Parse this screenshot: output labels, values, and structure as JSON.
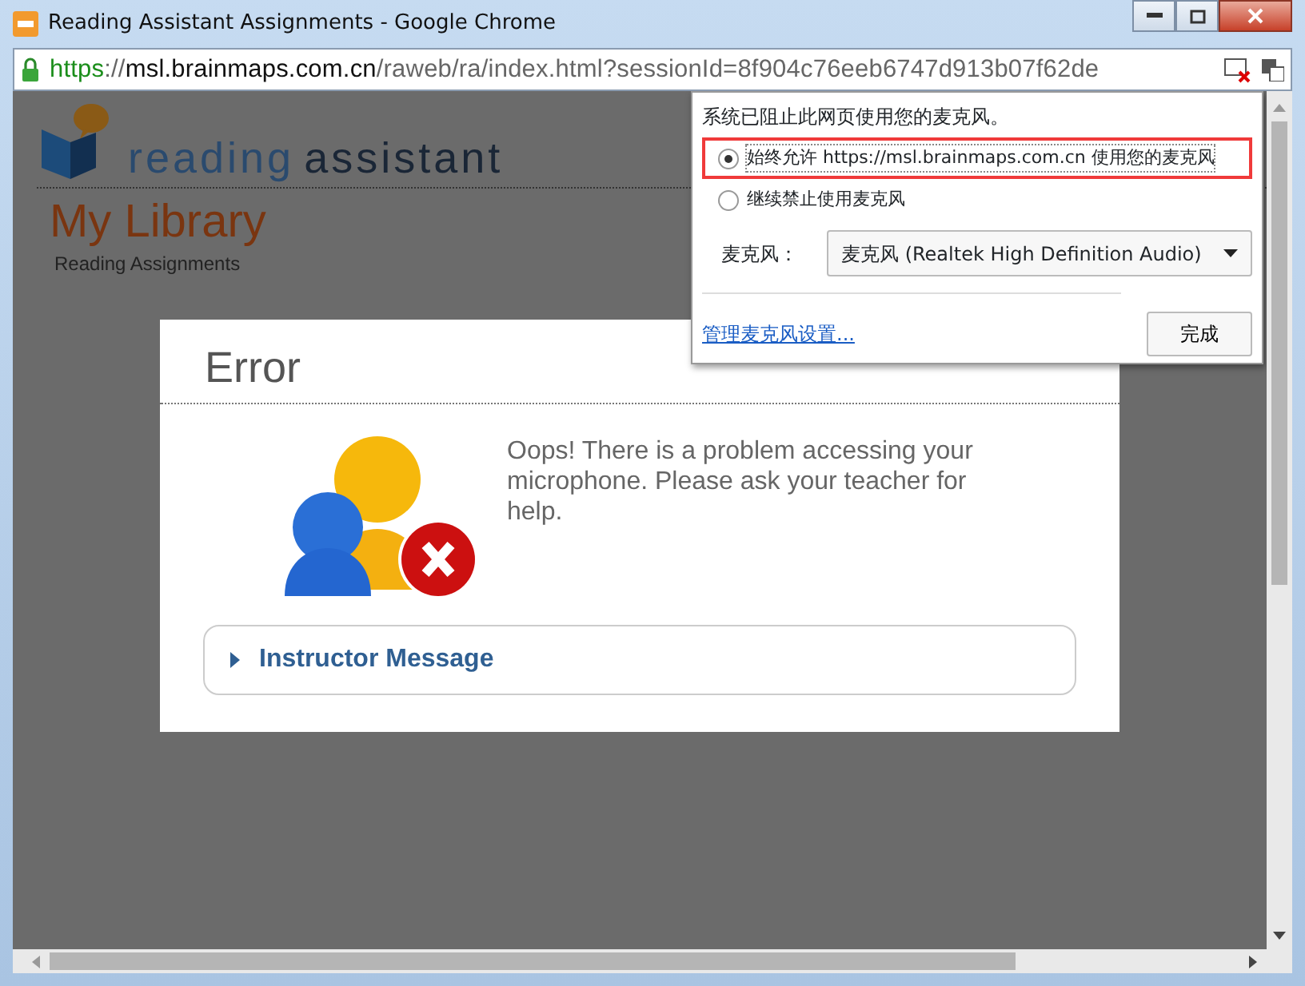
{
  "window": {
    "title": "Reading Assistant Assignments - Google Chrome"
  },
  "address_bar": {
    "scheme": "https",
    "separator": "://",
    "host": "msl.brainmaps.com.cn",
    "path": "/raweb/ra/index.html?sessionId=8f904c76eeb6747d913b07f62de"
  },
  "page": {
    "logo": {
      "word_1": "reading",
      "word_2": "assistant"
    },
    "heading": "My Library",
    "subheading": "Reading Assignments"
  },
  "error_dialog": {
    "title": "Error",
    "message": "Oops! There is a problem accessing your microphone. Please ask your teacher for help.",
    "instructor_message": {
      "label": "Instructor Message",
      "expanded": false
    }
  },
  "mic_popup": {
    "notice": "系统已阻止此网页使用您的麦克风。",
    "options": [
      {
        "label": "始终允许 https://msl.brainmaps.com.cn 使用您的麦克风",
        "selected": true
      },
      {
        "label": "继续禁止使用麦克风",
        "selected": false
      }
    ],
    "device_label": "麦克风：",
    "device_value": "麦克风 (Realtek High Definition Audio)",
    "manage_link": "管理麦克风设置...",
    "done_button": "完成"
  }
}
